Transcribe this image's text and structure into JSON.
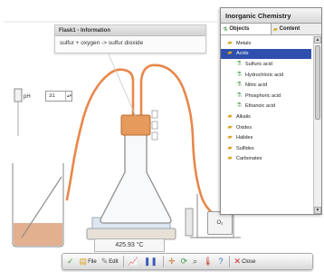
{
  "info_box": {
    "title": "Flask1 - Information",
    "text": "sulfur + oxygen -> sulfur dioxide"
  },
  "ph": {
    "label": "pH",
    "value": "31"
  },
  "temperature": "425.93 °C",
  "canister_label": "O₂",
  "panel": {
    "title": "Inorganic Chemistry",
    "tabs": [
      {
        "label": "Objects",
        "icon": "flask-icon"
      },
      {
        "label": "Content",
        "icon": "folder-icon"
      }
    ],
    "items": [
      {
        "label": "Metals",
        "level": 0,
        "icon": "folder-icon",
        "selected": false
      },
      {
        "label": "Acids",
        "level": 0,
        "icon": "folder-icon",
        "selected": true
      },
      {
        "label": "Sulfuric acid",
        "level": 1,
        "icon": "flask-icon",
        "selected": false
      },
      {
        "label": "Hydrochloric acid",
        "level": 1,
        "icon": "flask-icon",
        "selected": false
      },
      {
        "label": "Nitric acid",
        "level": 1,
        "icon": "flask-icon",
        "selected": false
      },
      {
        "label": "Phosphoric acid",
        "level": 1,
        "icon": "flask-icon",
        "selected": false
      },
      {
        "label": "Ethanoic acid",
        "level": 1,
        "icon": "flask-icon",
        "selected": false
      },
      {
        "label": "Alkalis",
        "level": 0,
        "icon": "folder-icon",
        "selected": false
      },
      {
        "label": "Oxides",
        "level": 0,
        "icon": "folder-icon",
        "selected": false
      },
      {
        "label": "Halides",
        "level": 0,
        "icon": "folder-icon",
        "selected": false
      },
      {
        "label": "Sulfides",
        "level": 0,
        "icon": "folder-icon",
        "selected": false
      },
      {
        "label": "Carbonates",
        "level": 0,
        "icon": "folder-icon",
        "selected": false
      }
    ]
  },
  "toolbar": {
    "file_label": "File",
    "edit_label": "Edit",
    "close_label": "Close"
  },
  "colors": {
    "tube": "#e8874a",
    "liquid": "#e2b08f",
    "selection": "#2e4fae",
    "flame": "#3a7fd6"
  }
}
